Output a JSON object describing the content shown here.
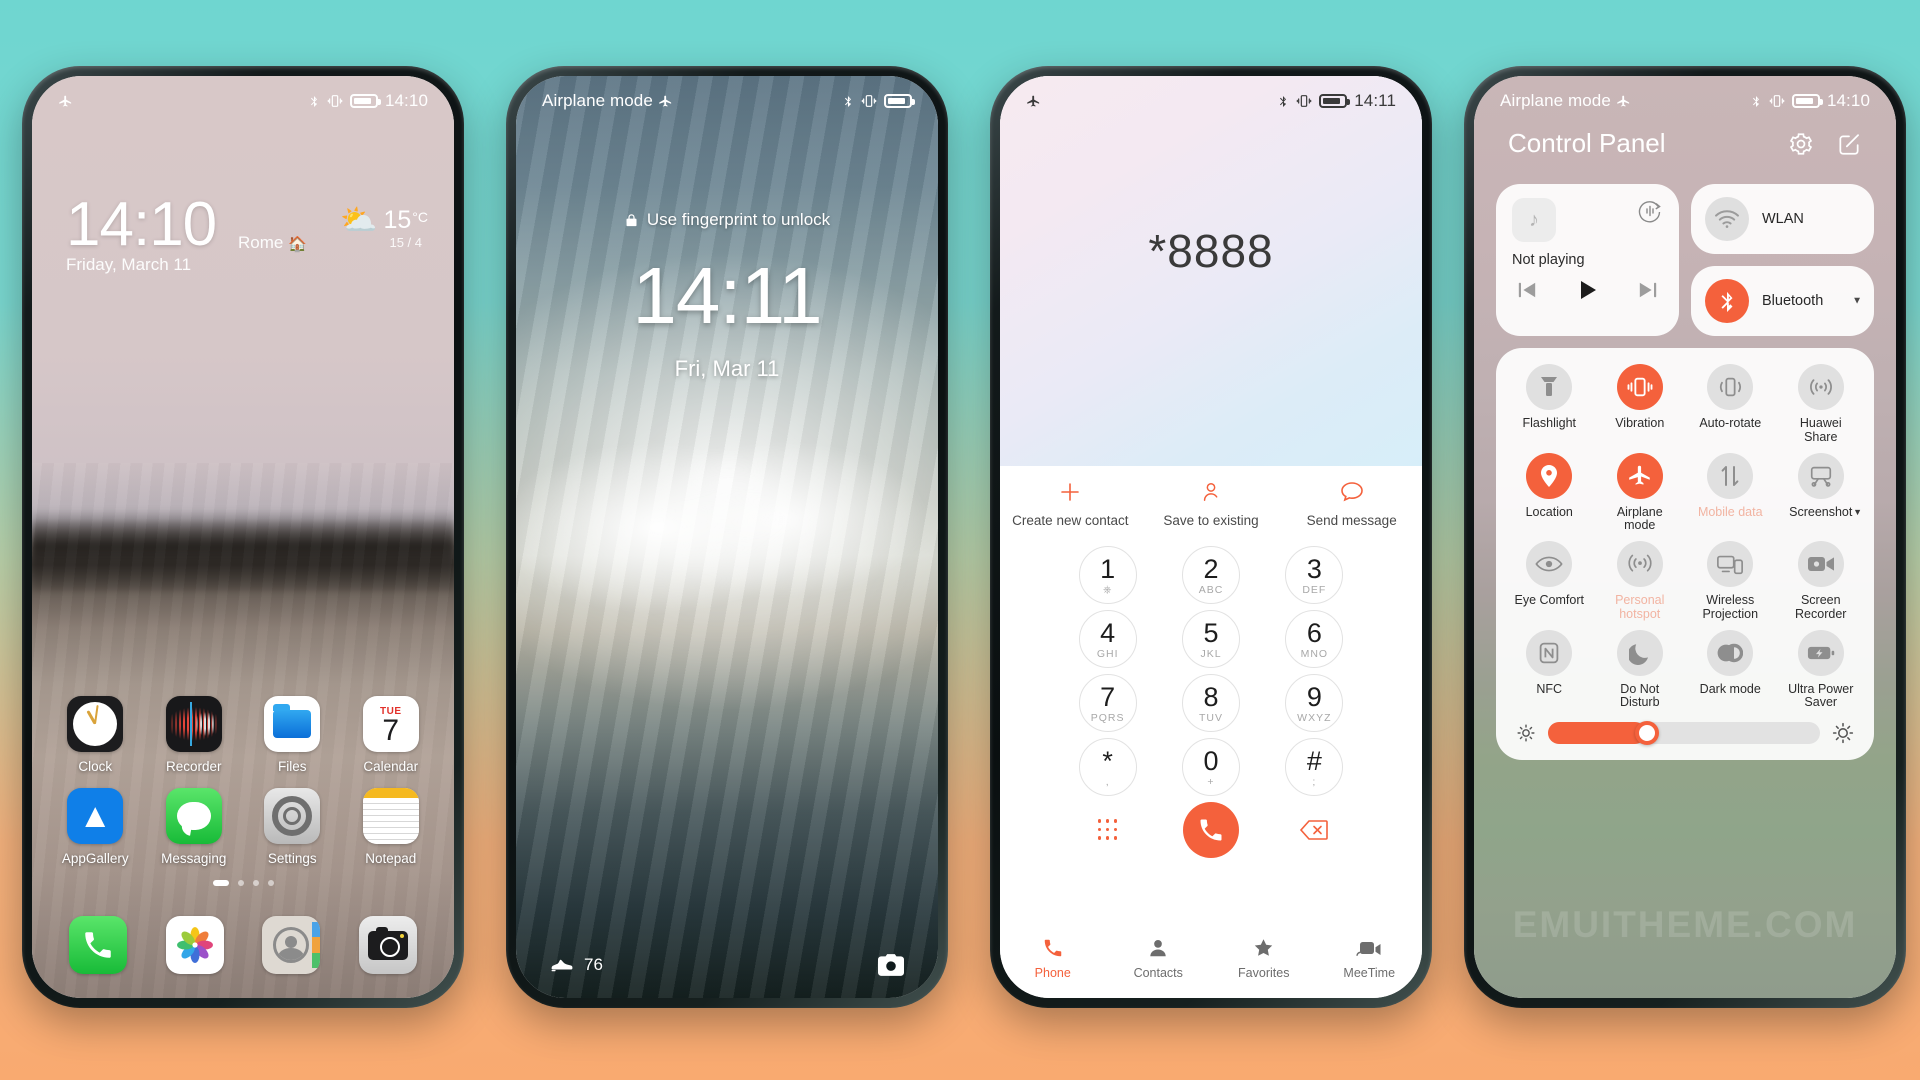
{
  "background": {
    "top_color": "#7ad7cf",
    "bottom_color": "#f9aa70"
  },
  "accent": "#f4613c",
  "phone1": {
    "name": "home-screen",
    "statusbar": {
      "left_icon": "airplane-icon",
      "bluetooth": "bluetooth-icon",
      "vibrate": "vibrate-icon",
      "battery": "battery-icon",
      "time": "14:10"
    },
    "clock": {
      "time": "14:10",
      "city": "Rome",
      "home_icon": "home-icon",
      "date": "Friday, March 11"
    },
    "weather": {
      "icon": "partly-cloudy-icon",
      "temp": "15",
      "unit": "°C",
      "range": "15 / 4"
    },
    "apps_row1": [
      {
        "label": "Clock",
        "icon": "clock-app-icon"
      },
      {
        "label": "Recorder",
        "icon": "recorder-app-icon"
      },
      {
        "label": "Files",
        "icon": "files-app-icon"
      },
      {
        "label": "Calendar",
        "icon": "calendar-app-icon",
        "day": "TUE",
        "date": "7"
      }
    ],
    "apps_row2": [
      {
        "label": "AppGallery",
        "icon": "appgallery-app-icon"
      },
      {
        "label": "Messaging",
        "icon": "messaging-app-icon"
      },
      {
        "label": "Settings",
        "icon": "settings-app-icon"
      },
      {
        "label": "Notepad",
        "icon": "notepad-app-icon"
      }
    ],
    "page_dots": 4,
    "active_dot": 0,
    "dock": [
      {
        "label": "Phone",
        "icon": "phone-app-icon"
      },
      {
        "label": "Gallery",
        "icon": "photos-app-icon"
      },
      {
        "label": "Contacts",
        "icon": "contacts-app-icon"
      },
      {
        "label": "Camera",
        "icon": "camera-app-icon"
      }
    ]
  },
  "phone2": {
    "name": "lock-screen",
    "statusbar": {
      "left_text": "Airplane mode",
      "left_icon": "airplane-icon",
      "bluetooth": "bluetooth-icon",
      "vibrate": "vibrate-icon",
      "battery": "battery-icon"
    },
    "unlock_hint": "Use fingerprint to unlock",
    "lock_icon": "lock-icon",
    "time": "14:11",
    "date": "Fri, Mar 11",
    "steps": {
      "icon": "shoe-icon",
      "value": "76"
    },
    "camera_shortcut": "camera-icon"
  },
  "phone3": {
    "name": "dialer",
    "statusbar": {
      "left_icon": "airplane-icon",
      "bluetooth": "bluetooth-icon",
      "vibrate": "vibrate-icon",
      "battery": "battery-icon",
      "time": "14:11"
    },
    "dialed_number": "*8888",
    "actions": [
      {
        "label": "Create new contact",
        "icon": "plus-icon"
      },
      {
        "label": "Save to existing",
        "icon": "person-icon"
      },
      {
        "label": "Send message",
        "icon": "message-icon"
      }
    ],
    "keys": [
      {
        "num": "1",
        "sub": ""
      },
      {
        "num": "2",
        "sub": "ABC"
      },
      {
        "num": "3",
        "sub": "DEF"
      },
      {
        "num": "4",
        "sub": "GHI"
      },
      {
        "num": "5",
        "sub": "JKL"
      },
      {
        "num": "6",
        "sub": "MNO"
      },
      {
        "num": "7",
        "sub": "PQRS"
      },
      {
        "num": "8",
        "sub": "TUV"
      },
      {
        "num": "9",
        "sub": "WXYZ"
      },
      {
        "num": "*",
        "sub": ","
      },
      {
        "num": "0",
        "sub": "+"
      },
      {
        "num": "#",
        "sub": ";"
      }
    ],
    "key1_sub_icon": "voicemail-icon",
    "controls": {
      "keypad_toggle": "keypad-dots-icon",
      "call": "call-icon",
      "delete": "backspace-icon"
    },
    "navbar": [
      {
        "label": "Phone",
        "icon": "phone-icon",
        "active": true
      },
      {
        "label": "Contacts",
        "icon": "contacts-icon",
        "active": false
      },
      {
        "label": "Favorites",
        "icon": "star-icon",
        "active": false
      },
      {
        "label": "MeeTime",
        "icon": "meetime-icon",
        "active": false
      }
    ]
  },
  "phone4": {
    "name": "control-panel",
    "statusbar": {
      "left_text": "Airplane mode",
      "left_icon": "airplane-icon",
      "bluetooth": "bluetooth-icon",
      "vibrate": "vibrate-icon",
      "battery": "battery-icon",
      "time": "14:10"
    },
    "title": "Control Panel",
    "header_actions": [
      "gear-icon",
      "edit-icon"
    ],
    "media": {
      "status": "Not playing",
      "album_icon": "music-note-icon",
      "cast_icon": "cast-audio-icon",
      "prev": "previous-icon",
      "play": "play-icon",
      "next": "next-icon"
    },
    "tiles": [
      {
        "label": "WLAN",
        "icon": "wifi-icon",
        "on": false,
        "chevron": false
      },
      {
        "label": "Bluetooth",
        "icon": "bluetooth-icon",
        "on": true,
        "chevron": true
      }
    ],
    "toggles": [
      {
        "label": "Flashlight",
        "icon": "flashlight-icon",
        "on": false,
        "dim": false
      },
      {
        "label": "Vibration",
        "icon": "vibration-icon",
        "on": true,
        "dim": false
      },
      {
        "label": "Auto-rotate",
        "icon": "auto-rotate-icon",
        "on": false,
        "dim": false
      },
      {
        "label": "Huawei Share",
        "icon": "huawei-share-icon",
        "on": false,
        "dim": false
      },
      {
        "label": "Location",
        "icon": "location-icon",
        "on": true,
        "dim": false
      },
      {
        "label": "Airplane mode",
        "icon": "airplane-icon",
        "on": true,
        "dim": false
      },
      {
        "label": "Mobile data",
        "icon": "mobile-data-icon",
        "on": false,
        "dim": true
      },
      {
        "label": "Screenshot",
        "icon": "screenshot-icon",
        "on": false,
        "dim": false,
        "chevron": true
      },
      {
        "label": "Eye Comfort",
        "icon": "eye-comfort-icon",
        "on": false,
        "dim": false
      },
      {
        "label": "Personal hotspot",
        "icon": "hotspot-icon",
        "on": false,
        "dim": true
      },
      {
        "label": "Wireless Projection",
        "icon": "wireless-projection-icon",
        "on": false,
        "dim": false
      },
      {
        "label": "Screen Recorder",
        "icon": "screen-recorder-icon",
        "on": false,
        "dim": false
      },
      {
        "label": "NFC",
        "icon": "nfc-icon",
        "on": false,
        "dim": false
      },
      {
        "label": "Do Not Disturb",
        "icon": "moon-icon",
        "on": false,
        "dim": false
      },
      {
        "label": "Dark mode",
        "icon": "dark-mode-icon",
        "on": false,
        "dim": false
      },
      {
        "label": "Ultra Power Saver",
        "icon": "ultra-power-saver-icon",
        "on": false,
        "dim": false
      }
    ],
    "brightness": {
      "min_icon": "brightness-low-icon",
      "max_icon": "brightness-high-icon",
      "value": 36
    },
    "watermark": "EMUITHEME.COM"
  }
}
